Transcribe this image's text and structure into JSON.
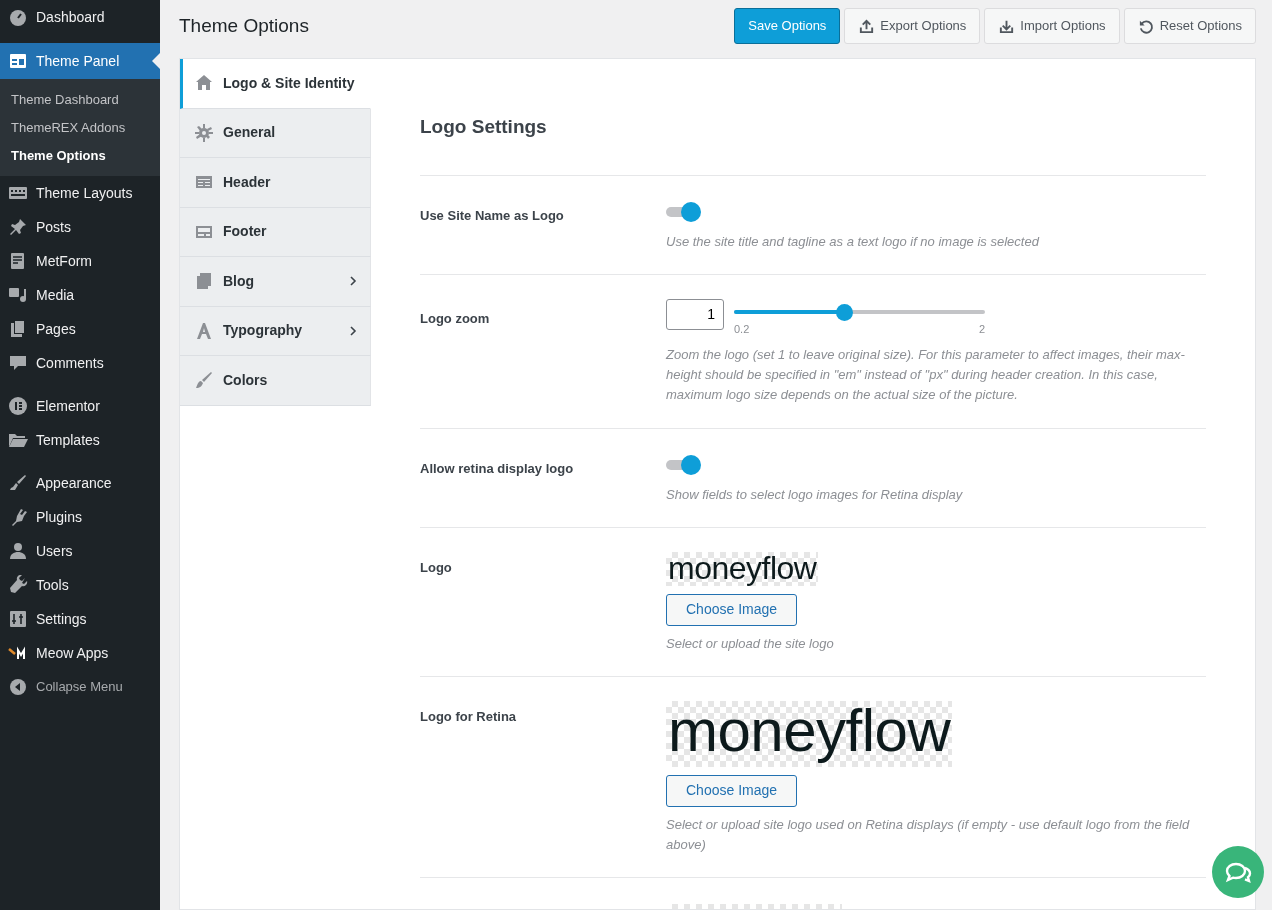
{
  "sidebar": {
    "groups": [
      [
        {
          "label": "Dashboard",
          "selected": false
        }
      ],
      [
        {
          "label": "Theme Panel",
          "selected": true,
          "submenu": [
            {
              "label": "Theme Dashboard",
              "selected": false
            },
            {
              "label": "ThemeREX Addons",
              "selected": false
            },
            {
              "label": "Theme Options",
              "selected": true
            }
          ]
        },
        {
          "label": "Theme Layouts",
          "selected": false
        }
      ],
      [
        {
          "label": "Posts",
          "selected": false
        },
        {
          "label": "MetForm",
          "selected": false
        },
        {
          "label": "Media",
          "selected": false
        },
        {
          "label": "Pages",
          "selected": false
        },
        {
          "label": "Comments",
          "selected": false
        }
      ],
      [
        {
          "label": "Elementor",
          "selected": false
        },
        {
          "label": "Templates",
          "selected": false
        }
      ],
      [
        {
          "label": "Appearance",
          "selected": false
        },
        {
          "label": "Plugins",
          "selected": false
        },
        {
          "label": "Users",
          "selected": false
        },
        {
          "label": "Tools",
          "selected": false
        },
        {
          "label": "Settings",
          "selected": false
        },
        {
          "label": "Meow Apps",
          "selected": false
        },
        {
          "label": "Collapse Menu",
          "selected": false,
          "kind": "collapse"
        }
      ]
    ]
  },
  "page_title": "Theme Options",
  "toolbar": [
    {
      "label": "Save Options",
      "kind": "primary"
    },
    {
      "label": "Export Options",
      "kind": "export"
    },
    {
      "label": "Import Options",
      "kind": "import"
    },
    {
      "label": "Reset Options",
      "kind": "reset"
    }
  ],
  "tabs": [
    {
      "label": "Logo & Site Identity",
      "selected": true,
      "expandable": false
    },
    {
      "label": "General",
      "selected": false,
      "expandable": false
    },
    {
      "label": "Header",
      "selected": false,
      "expandable": false
    },
    {
      "label": "Footer",
      "selected": false,
      "expandable": false
    },
    {
      "label": "Blog",
      "selected": false,
      "expandable": true
    },
    {
      "label": "Typography",
      "selected": false,
      "expandable": true
    },
    {
      "label": "Colors",
      "selected": false,
      "expandable": false
    }
  ],
  "section_title": "Logo Settings",
  "settings": [
    {
      "kind": "toggle",
      "label": "Use Site Name as Logo",
      "on": true,
      "description": "Use the site title and tagline as a text logo if no image is selected"
    },
    {
      "kind": "slider",
      "label": "Logo zoom",
      "value": "1",
      "min": "0.2",
      "max": "2",
      "level": 0.44,
      "description": "Zoom the logo (set 1 to leave original size). For this parameter to affect images, their max-height should be specified in \"em\" instead of \"px\" during header creation. In this case, maximum logo size depends on the actual size of the picture."
    },
    {
      "kind": "toggle",
      "label": "Allow retina display logo",
      "on": true,
      "description": "Show fields to select logo images for Retina display"
    },
    {
      "kind": "image",
      "label": "Logo",
      "preview": "moneyflow",
      "button": "Choose Image",
      "description": "Select or upload the site logo"
    },
    {
      "kind": "retina-image",
      "label": "Logo for Retina",
      "preview": "moneyflow",
      "button": "Choose Image",
      "description": "Select or upload site logo used on Retina displays (if empty - use default logo from the field above)"
    }
  ]
}
